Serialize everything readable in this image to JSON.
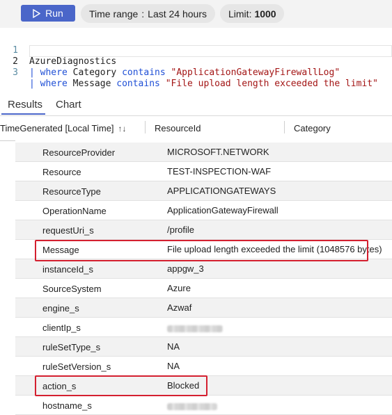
{
  "toolbar": {
    "run_label": "Run",
    "time_range_label": "Time range",
    "time_range_separator": ":",
    "time_range_value": "Last 24 hours",
    "limit_label": "Limit",
    "limit_separator": ":",
    "limit_value": "1000"
  },
  "editor": {
    "lines": [
      {
        "num": "1",
        "text": "AzureDiagnostics"
      },
      {
        "num": "2",
        "pipe": "| ",
        "kw1": "where",
        "field": " Category ",
        "kw2": "contains",
        "space": " ",
        "str": "\"ApplicationGatewayFirewallLog\""
      },
      {
        "num": "3",
        "pipe": "| ",
        "kw1": "where",
        "field": " Message ",
        "kw2": "contains",
        "space": " ",
        "str": "\"File upload length exceeded the limit\""
      }
    ]
  },
  "tabs": [
    {
      "label": "Results",
      "active": true
    },
    {
      "label": "Chart",
      "active": false
    }
  ],
  "columns": [
    "TimeGenerated [Local Time]",
    "ResourceId",
    "Category"
  ],
  "sort_icon": "↑↓",
  "details": [
    {
      "key": "ResourceProvider",
      "value": "MICROSOFT.NETWORK"
    },
    {
      "key": "Resource",
      "value": "TEST-INSPECTION-WAF"
    },
    {
      "key": "ResourceType",
      "value": "APPLICATIONGATEWAYS"
    },
    {
      "key": "OperationName",
      "value": "ApplicationGatewayFirewall"
    },
    {
      "key": "requestUri_s",
      "value": "/profile"
    },
    {
      "key": "Message",
      "value": "File upload length exceeded the limit (1048576 bytes)"
    },
    {
      "key": "instanceId_s",
      "value": "appgw_3"
    },
    {
      "key": "SourceSystem",
      "value": "Azure"
    },
    {
      "key": "engine_s",
      "value": "Azwaf"
    },
    {
      "key": "clientIp_s",
      "value": ""
    },
    {
      "key": "ruleSetType_s",
      "value": "NA"
    },
    {
      "key": "ruleSetVersion_s",
      "value": "NA"
    },
    {
      "key": "action_s",
      "value": "Blocked"
    },
    {
      "key": "hostname_s",
      "value": ""
    }
  ],
  "colors": {
    "accent": "#4a66c9",
    "highlight": "#d41f2f",
    "keyword": "#1f4fd6",
    "string": "#a31515"
  }
}
